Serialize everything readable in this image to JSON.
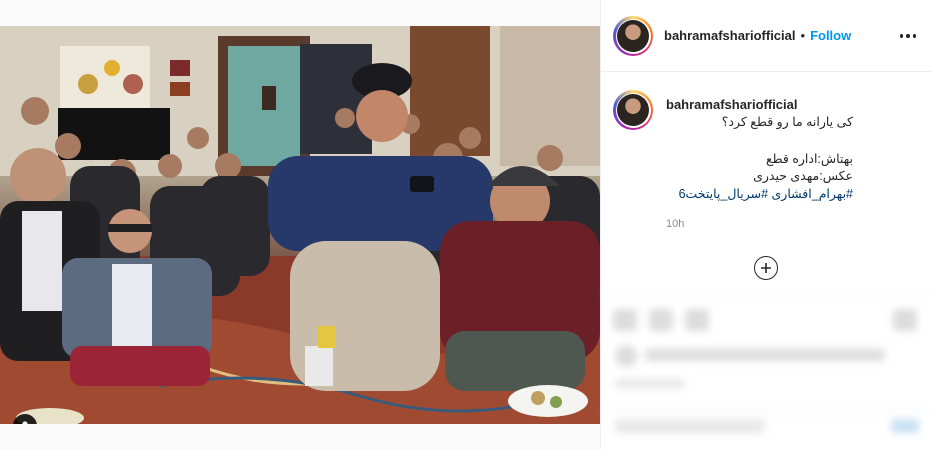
{
  "post": {
    "username": "bahramafshariofficial",
    "separator": "•",
    "follow_label": "Follow",
    "caption": {
      "line1": "کی یارانه ما رو قطع کرد؟",
      "line2": "بهتاش:اداره قطع",
      "line3": "عکس:مهدی حیدری",
      "hashtags": "#بهرام_افشاری #سریال_پایتخت6"
    },
    "time_ago": "10h"
  },
  "icons": {
    "more": "more-options-icon",
    "load_more": "plus-circle-icon",
    "tag": "user-tag-icon"
  },
  "colors": {
    "accent": "#0095f6",
    "hashtag": "#00376b",
    "muted": "#8e8e8e"
  }
}
